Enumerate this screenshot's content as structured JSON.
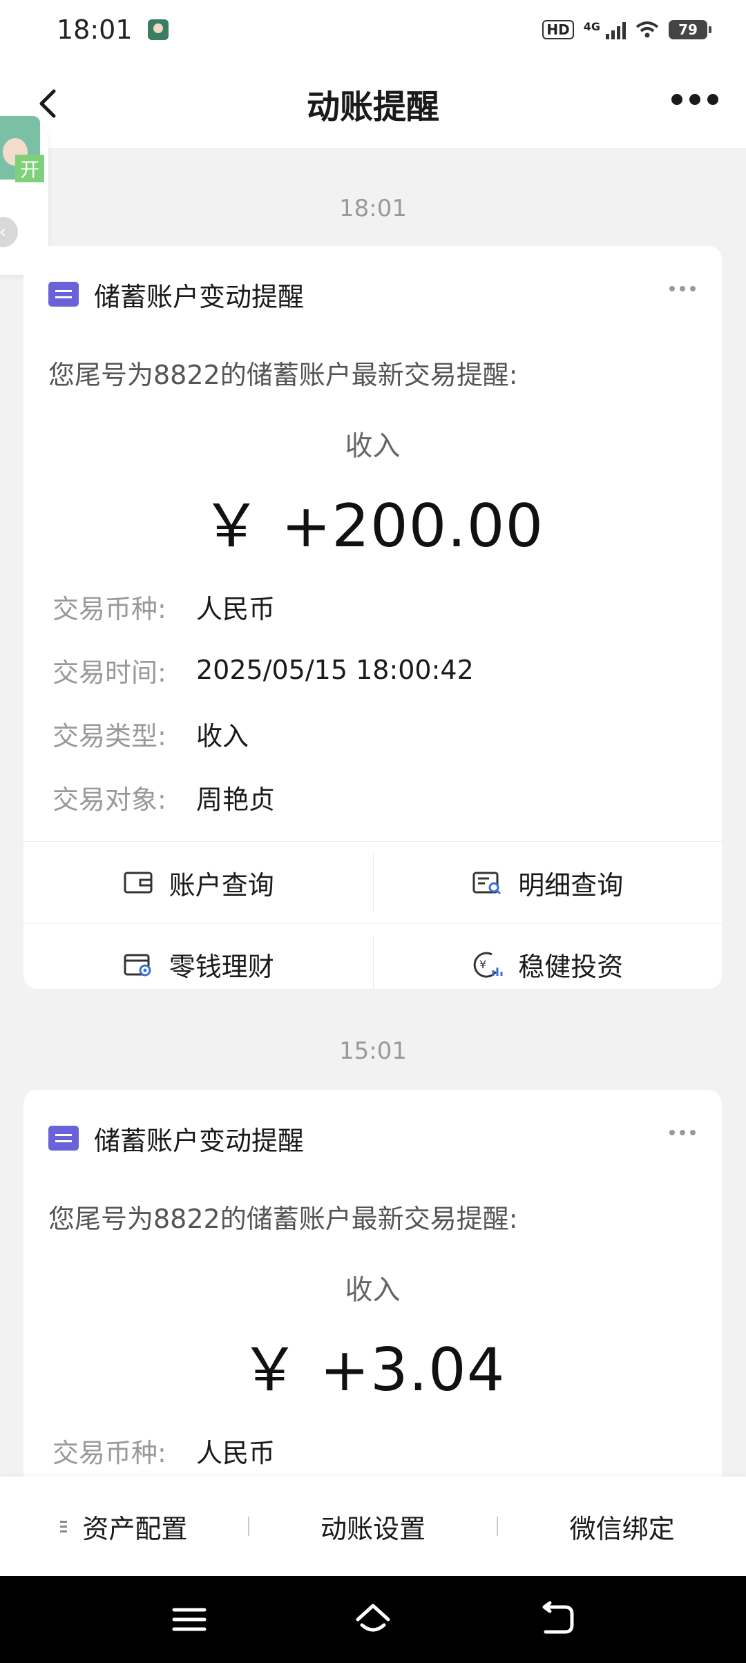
{
  "status_bar": {
    "time": "18:01",
    "hd": "HD",
    "network": "4G",
    "battery": "79"
  },
  "header": {
    "title": "动账提醒"
  },
  "float_avatar": {
    "tag": "开"
  },
  "messages": [
    {
      "time": "18:01",
      "title": "储蓄账户变动提醒",
      "description": "您尾号为8822的储蓄账户最新交易提醒:",
      "kind": "收入",
      "amount": "￥ +200.00",
      "details": [
        {
          "label": "交易币种:",
          "value": "人民币"
        },
        {
          "label": "交易时间:",
          "value": "2025/05/15 18:00:42"
        },
        {
          "label": "交易类型:",
          "value": "收入"
        },
        {
          "label": "交易对象:",
          "value": "周艳贞"
        }
      ],
      "actions": [
        "账户查询",
        "明细查询",
        "零钱理财",
        "稳健投资"
      ]
    },
    {
      "time": "15:01",
      "title": "储蓄账户变动提醒",
      "description": "您尾号为8822的储蓄账户最新交易提醒:",
      "kind": "收入",
      "amount": "￥ +3.04",
      "details": [
        {
          "label": "交易币种:",
          "value": "人民币"
        }
      ]
    }
  ],
  "bottom_tabs": [
    "资产配置",
    "动账设置",
    "微信绑定"
  ],
  "colors": {
    "accent": "#6a62d9",
    "background": "#f2f2f2",
    "muted": "#999999"
  }
}
